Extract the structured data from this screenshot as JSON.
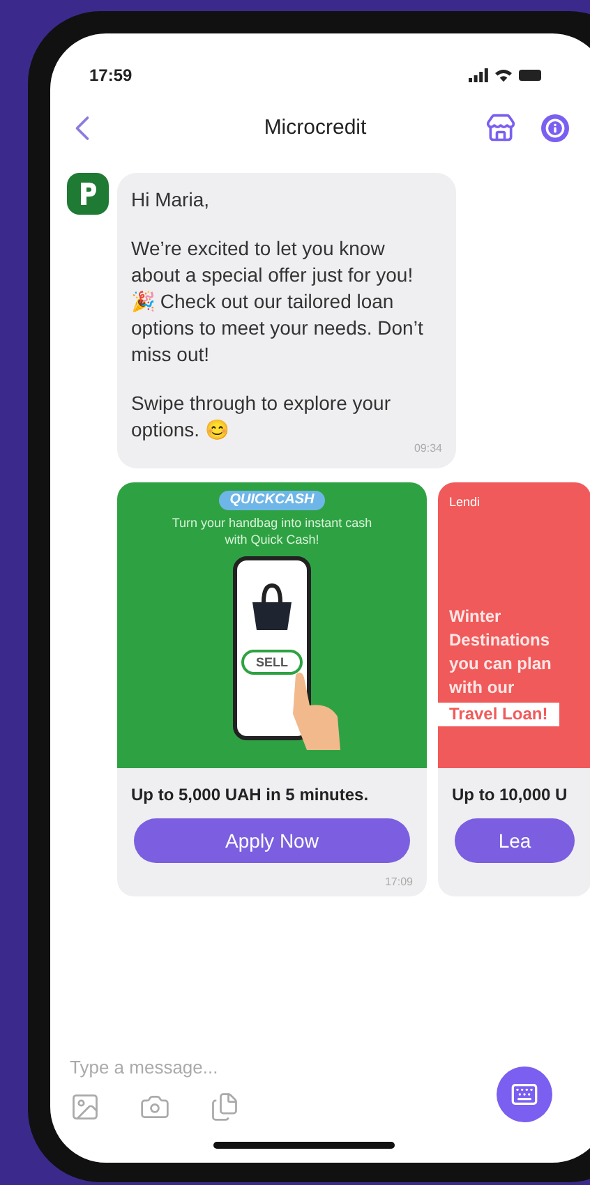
{
  "status_bar": {
    "time": "17:59"
  },
  "header": {
    "title": "Microcredit"
  },
  "message": {
    "paragraphs": [
      "Hi Maria,",
      "We’re excited to let you know about a special offer just for you! 🎉 Check out our tailored loan options to meet your needs. Don’t miss out!",
      "Swipe through to explore your options. 😊"
    ],
    "time": "09:34"
  },
  "cards": [
    {
      "kind": "phone-promo",
      "brand": "QUICKCASH",
      "caption": "Turn your handbag into instant cash with Quick Cash!",
      "phone_button": "SELL",
      "headline": "Up to 5,000 UAH in 5 minutes.",
      "button": "Apply Now",
      "time": "17:09"
    },
    {
      "kind": "text-promo",
      "brand": "Lendi",
      "caption": "Winter Destinations you can plan with our",
      "highlight": "Travel Loan!",
      "headline": "Up to 10,000 U",
      "button": "Lea"
    }
  ],
  "composer": {
    "placeholder": "Type a message..."
  }
}
